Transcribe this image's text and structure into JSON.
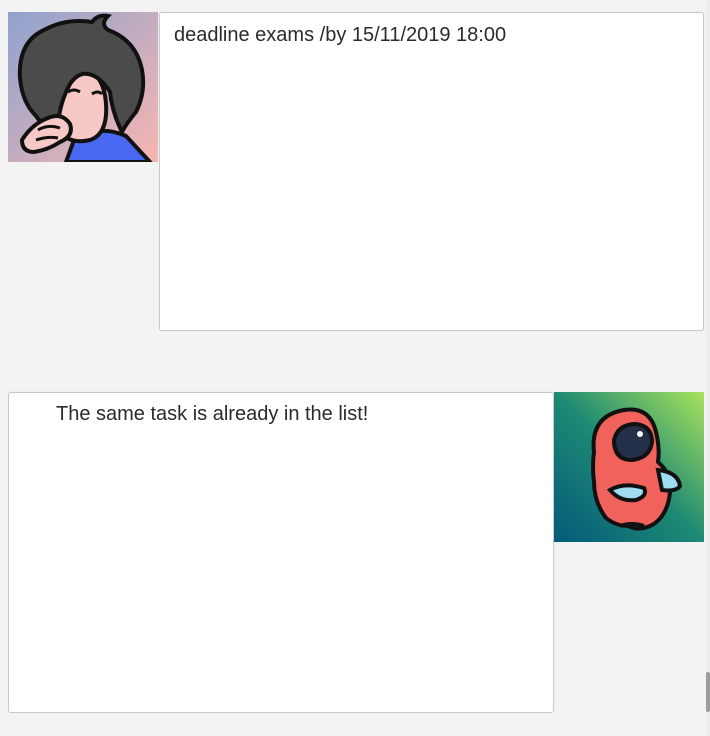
{
  "chat": {
    "messages": [
      {
        "sender": "user",
        "text": "deadline exams /by 15/11/2019 18:00",
        "avatar_icon": "user-cartoon-avatar-icon"
      },
      {
        "sender": "bot",
        "text": "The same task is already in the list!",
        "avatar_icon": "bot-red-creature-avatar-icon"
      }
    ]
  },
  "colors": {
    "page_background": "#f3f3f3",
    "bubble_background": "#ffffff",
    "bubble_border": "#c9c9c9",
    "text": "#2b2b2b",
    "user_avatar_background": "#e8b4b8",
    "bot_avatar_background": "#0e6f78",
    "bot_creature": "#f2625c"
  }
}
